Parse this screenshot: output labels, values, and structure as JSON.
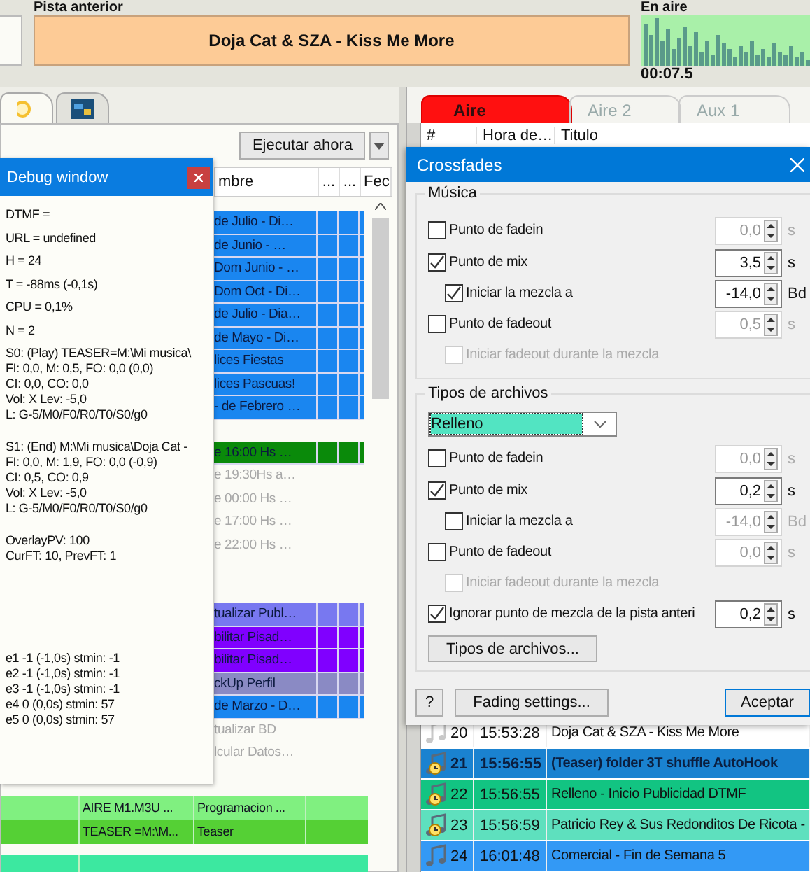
{
  "top": {
    "prev_label": "Pista anterior",
    "prev_track": "Doja Cat & SZA - Kiss Me More",
    "on_air_label": "En aire",
    "on_air_time": "00:07.5"
  },
  "left_tabs": [
    {
      "selected": true
    },
    {
      "selected": false
    }
  ],
  "left_panel": {
    "run_button": "Ejecutar ahora",
    "columns": [
      "mbre",
      "...",
      "...",
      "Fec"
    ],
    "row_groups": [
      [
        {
          "name": "de Julio - Di…",
          "color": "#1a86f0"
        },
        {
          "name": "de Junio - …",
          "color": "#1a86f0"
        },
        {
          "name": "Dom Junio - …",
          "color": "#1a86f0"
        },
        {
          "name": "Dom Oct - Di…",
          "color": "#1a86f0"
        },
        {
          "name": "de Julio - Dia…",
          "color": "#1a86f0"
        },
        {
          "name": "de Mayo - Di…",
          "color": "#1a86f0"
        },
        {
          "name": "lices Fiestas",
          "color": "#1a86f0"
        },
        {
          "name": "lices Pascuas!",
          "color": "#1a86f0"
        },
        {
          "name": "- de Febrero …",
          "color": "#1a86f0"
        }
      ],
      [
        {
          "name": "e 16:00 Hs …",
          "color": "#0a8a0a"
        },
        {
          "name": "e 19:30Hs a…"
        },
        {
          "name": "e 00:00 Hs …"
        },
        {
          "name": "e 17:00 Hs …"
        },
        {
          "name": "e 22:00 Hs …"
        }
      ],
      [
        {
          "name": "tualizar Publ…",
          "color": "#7878f0"
        },
        {
          "name": "bilitar Pisad…",
          "color": "#8000ff"
        },
        {
          "name": "bilitar Pisad…",
          "color": "#8000ff"
        },
        {
          "name": "ckUp Perfil",
          "color": "#8a8ac4"
        },
        {
          "name": "de Marzo - D…",
          "color": "#1a86f0"
        },
        {
          "name": "tualizar BD"
        },
        {
          "name": "lcular Datos…"
        }
      ]
    ],
    "bottom_rows": [
      {
        "cells": [
          "AIRE M1.M3U ...",
          "Programacion ..."
        ],
        "color": "#80f080"
      },
      {
        "cells": [
          "TEASER =M:\\M...",
          "Teaser"
        ],
        "color": "#55d035"
      },
      {
        "color": "#3ce8a0"
      }
    ]
  },
  "debug_window": {
    "title": "Debug window",
    "blocks": [
      {
        "kind": "loose",
        "lines": [
          "DTMF =",
          "URL = undefined",
          "H = 24",
          "T = -88ms (-0,1s)",
          "CPU = 0,1%",
          "N = 2"
        ]
      },
      {
        "kind": "tight",
        "lines": [
          "S0: (Play) TEASER=M:\\Mi musica\\",
          "FI: 0,0, M: 0,5, FO: 0,0 (0,0)",
          "CI: 0,0, CO: 0,0",
          "Vol: X Lev: -5,0",
          "L: G-5/M0/F0/R0/T0/S0/g0"
        ]
      },
      {
        "kind": "tight",
        "lines": [
          "S1: (End) M:\\Mi musica\\Doja Cat -",
          "FI: 0,0, M: 1,9, FO: 0,0 (-0,9)",
          "CI: 0,5, CO: 0,9",
          "Vol: X Lev: -5,0",
          "L: G-5/M0/F0/R0/T0/S0/g0"
        ]
      },
      {
        "kind": "tight",
        "lines": [
          "OverlayPV: 100",
          "CurFT: 10, PrevFT: 1"
        ]
      },
      {
        "kind": "tight",
        "lines": [
          "e1 -1 (-1,0s) stmin: -1",
          "e2 -1 (-1,0s) stmin: -1",
          "e3 -1 (-1,0s) stmin: -1",
          "e4 0 (0,0s) stmin: 57",
          "e5 0 (0,0s) stmin: 57"
        ]
      }
    ]
  },
  "right_tabs": [
    {
      "label": "Aire",
      "selected": true
    },
    {
      "label": "Aire 2",
      "selected": false
    },
    {
      "label": "Aux 1",
      "selected": false
    }
  ],
  "right_table": {
    "columns": [
      "#",
      "Hora de…",
      "Titulo"
    ],
    "rows": [
      {
        "kind": "played",
        "number": "20",
        "time": "15:53:28",
        "title": "Doja Cat & SZA - Kiss Me More",
        "color": "#ffffff",
        "selected": false
      },
      {
        "kind": "timed",
        "number": "21",
        "time": "15:56:55",
        "title": "(Teaser) folder 3T shuffle AutoHook",
        "color": "#1a82d0",
        "selected": true
      },
      {
        "kind": "timed",
        "number": "22",
        "time": "15:56:55",
        "title": "Relleno - Inicio Publicidad DTMF",
        "color": "#12c482",
        "selected": false
      },
      {
        "kind": "timed",
        "number": "23",
        "time": "15:56:59",
        "title": "Patricio Rey & Sus Redonditos De Ricota -",
        "color": "#5ee0be",
        "selected": false
      },
      {
        "kind": "plain",
        "number": "24",
        "time": "16:01:48",
        "title": "Comercial - Fin de Semana 5",
        "color": "#3399f5",
        "selected": false
      }
    ]
  },
  "crossfades": {
    "title": "Crossfades",
    "sections": [
      {
        "legend": "Música",
        "rows": [
          {
            "kind": "main",
            "label": "Punto de fadein",
            "checked": false,
            "disabled": false,
            "value": "0,0",
            "unit": "s"
          },
          {
            "kind": "main",
            "label": "Punto de mix",
            "checked": true,
            "disabled": false,
            "value": "3,5",
            "unit": "s"
          },
          {
            "kind": "sub",
            "label": "Iniciar la mezcla a",
            "checked": true,
            "disabled": false,
            "value": "-14,0",
            "unit": "Bd"
          },
          {
            "kind": "main",
            "label": "Punto de fadeout",
            "checked": false,
            "disabled": false,
            "value": "0,5",
            "unit": "s"
          },
          {
            "kind": "sub",
            "label": "Iniciar fadeout durante la mezcla",
            "checked": false,
            "disabled": true
          }
        ]
      },
      {
        "legend": "Tipos de archivos",
        "select": "Relleno",
        "rows": [
          {
            "kind": "main",
            "label": "Punto de fadein",
            "checked": false,
            "disabled": false,
            "value": "0,0",
            "unit": "s"
          },
          {
            "kind": "main",
            "label": "Punto de mix",
            "checked": true,
            "disabled": false,
            "value": "0,2",
            "unit": "s"
          },
          {
            "kind": "sub",
            "label": "Iniciar la mezcla a",
            "checked": false,
            "disabled": false,
            "value": "-14,0",
            "unit": "Bd"
          },
          {
            "kind": "main",
            "label": "Punto de fadeout",
            "checked": false,
            "disabled": false,
            "value": "0,0",
            "unit": "s"
          },
          {
            "kind": "sub",
            "label": "Iniciar fadeout durante la mezcla",
            "checked": false,
            "disabled": true
          },
          {
            "kind": "main",
            "label": "Ignorar punto de mezcla de la pista anteri",
            "checked": true,
            "disabled": false,
            "value": "0,2",
            "unit": "s"
          }
        ],
        "button": "Tipos de archivos..."
      }
    ],
    "help_button": "?",
    "settings_button": "Fading settings...",
    "ok_button": "Aceptar"
  }
}
